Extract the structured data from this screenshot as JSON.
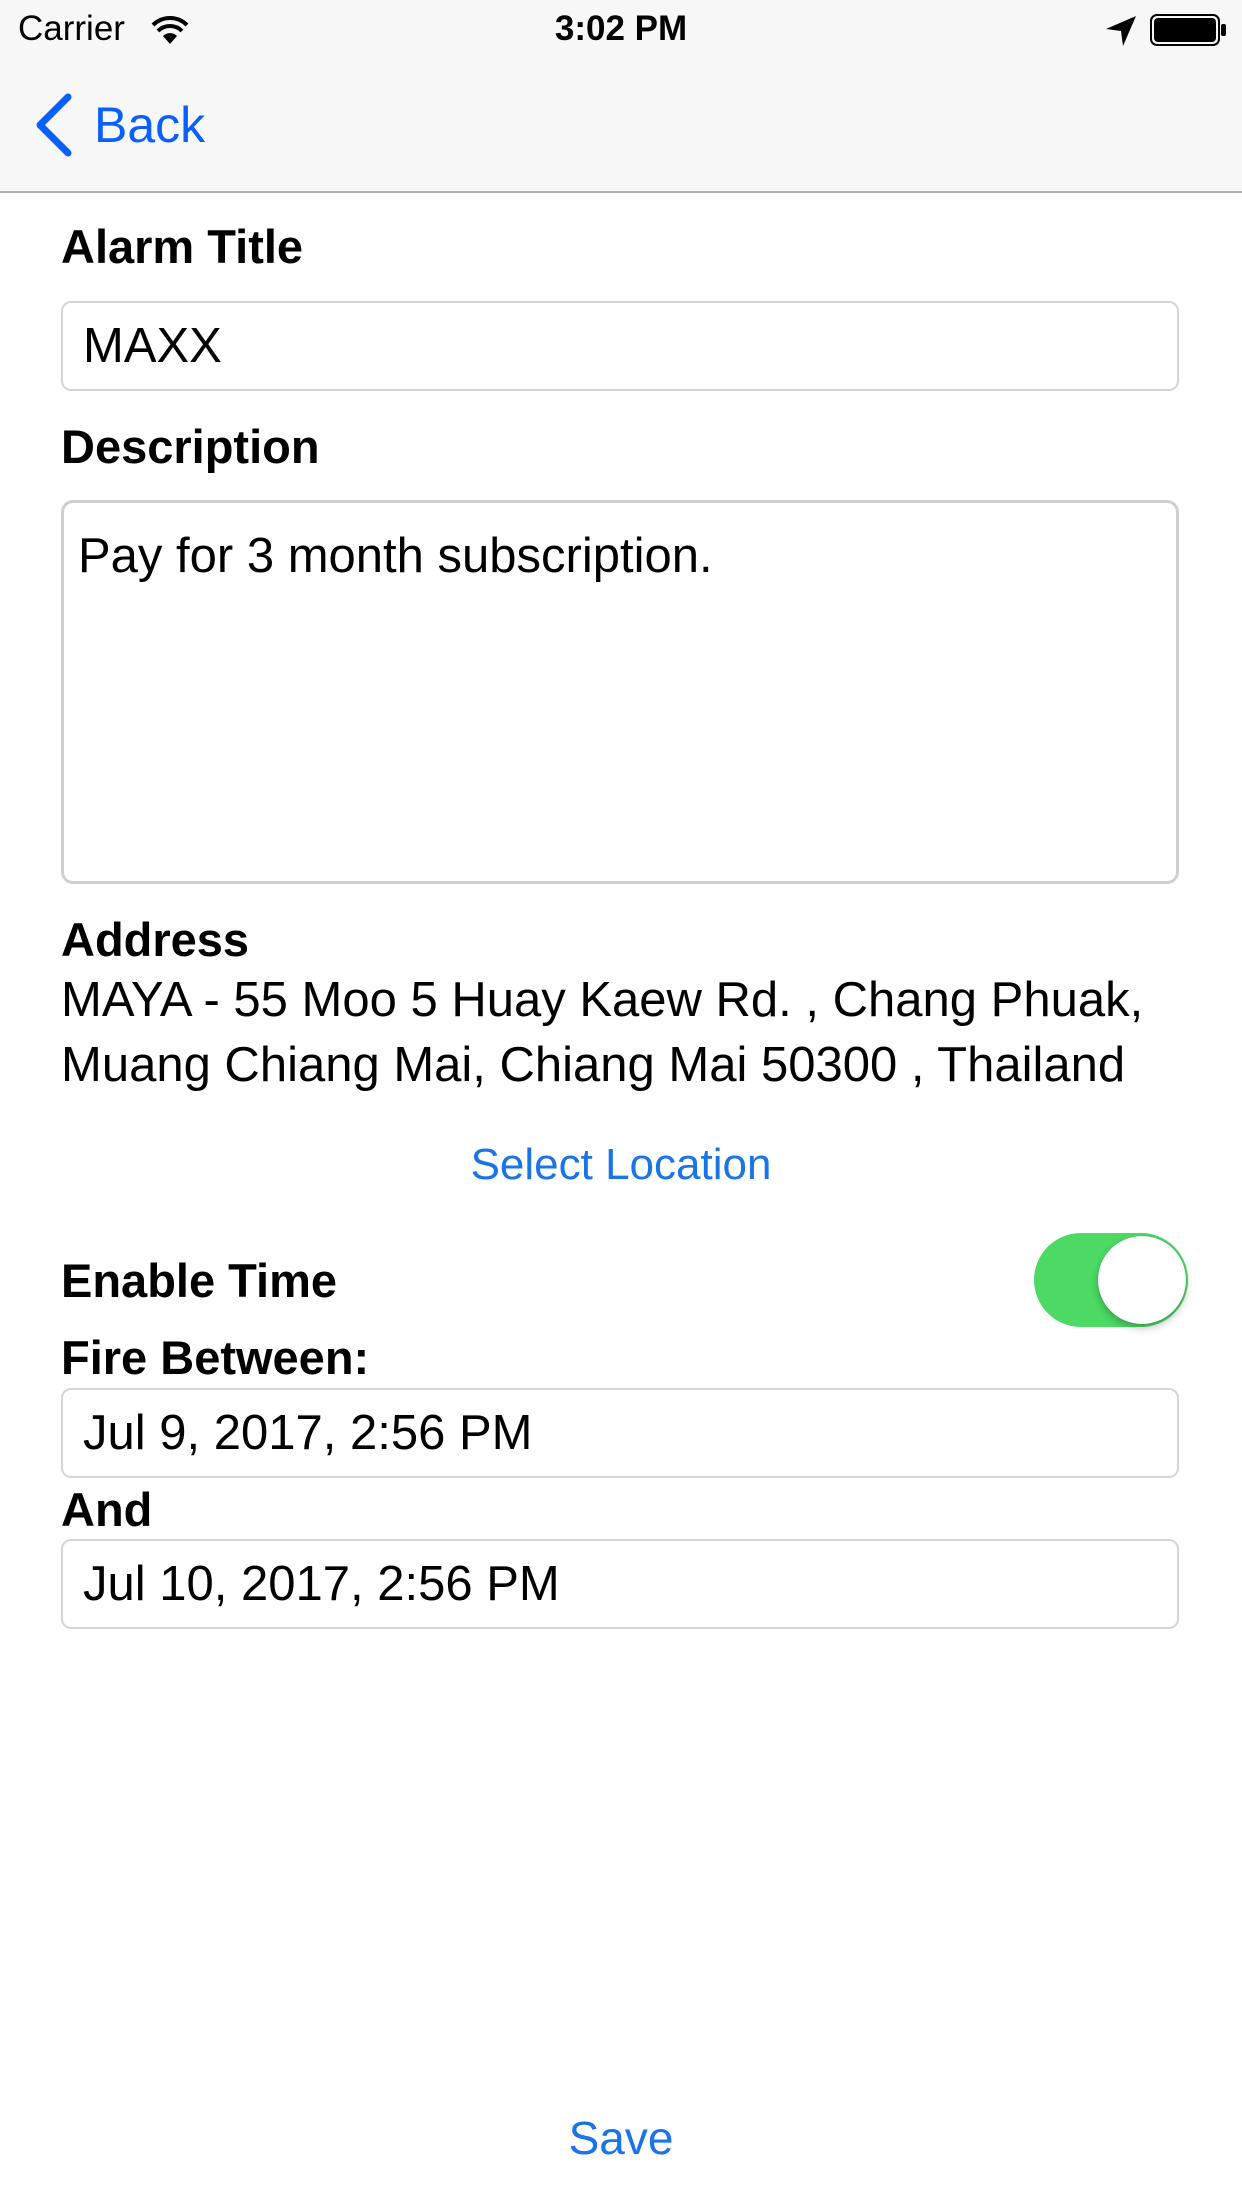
{
  "status_bar": {
    "carrier": "Carrier",
    "time": "3:02 PM",
    "icons": [
      "wifi-icon",
      "location-arrow-icon",
      "battery-icon"
    ]
  },
  "nav": {
    "back_label": "Back",
    "accent_color": "#0a5fff"
  },
  "form": {
    "title_label": "Alarm Title",
    "title_value": "MAXX",
    "description_label": "Description",
    "description_value": "Pay for 3 month subscription.",
    "address_label": "Address",
    "address_line1": "MAYA - 55 Moo 5 Huay Kaew Rd. , Chang Phuak,",
    "address_line2": "Muang Chiang Mai, Chiang Mai 50300 , Thailand",
    "select_location_label": "Select Location",
    "enable_time_label": "Enable Time",
    "enable_time_on": true,
    "toggle_color": "#4cd964",
    "fire_between_label": "Fire Between:",
    "start_datetime": "Jul 9, 2017, 2:56 PM",
    "and_label": "And",
    "end_datetime": "Jul 10, 2017, 2:56 PM"
  },
  "footer": {
    "save_label": "Save"
  }
}
